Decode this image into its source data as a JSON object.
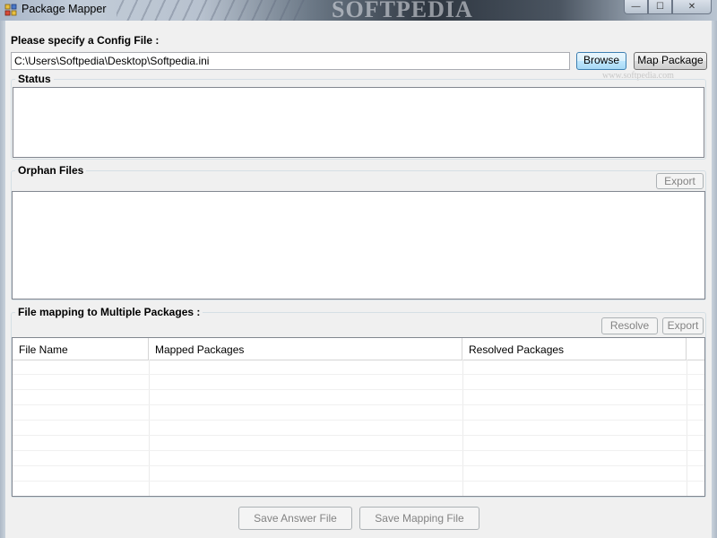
{
  "window": {
    "title": "Package Mapper",
    "watermark": "SOFTPEDIA",
    "controls": {
      "minimize": "—",
      "maximize": "☐",
      "close": "✕"
    }
  },
  "config": {
    "label": "Please specify a Config File :",
    "path": "C:\\Users\\Softpedia\\Desktop\\Softpedia.ini",
    "browse_label": "Browse",
    "map_label": "Map Package"
  },
  "page_watermark": "www.softpedia.com",
  "status": {
    "title": "Status"
  },
  "orphan": {
    "title": "Orphan Files",
    "export_label": "Export"
  },
  "mapping": {
    "title": "File mapping to Multiple Packages :",
    "resolve_label": "Resolve",
    "export_label": "Export",
    "columns": [
      "File Name",
      "Mapped Packages",
      "Resolved Packages"
    ]
  },
  "footer": {
    "save_answer_label": "Save Answer File",
    "save_mapping_label": "Save Mapping File"
  }
}
